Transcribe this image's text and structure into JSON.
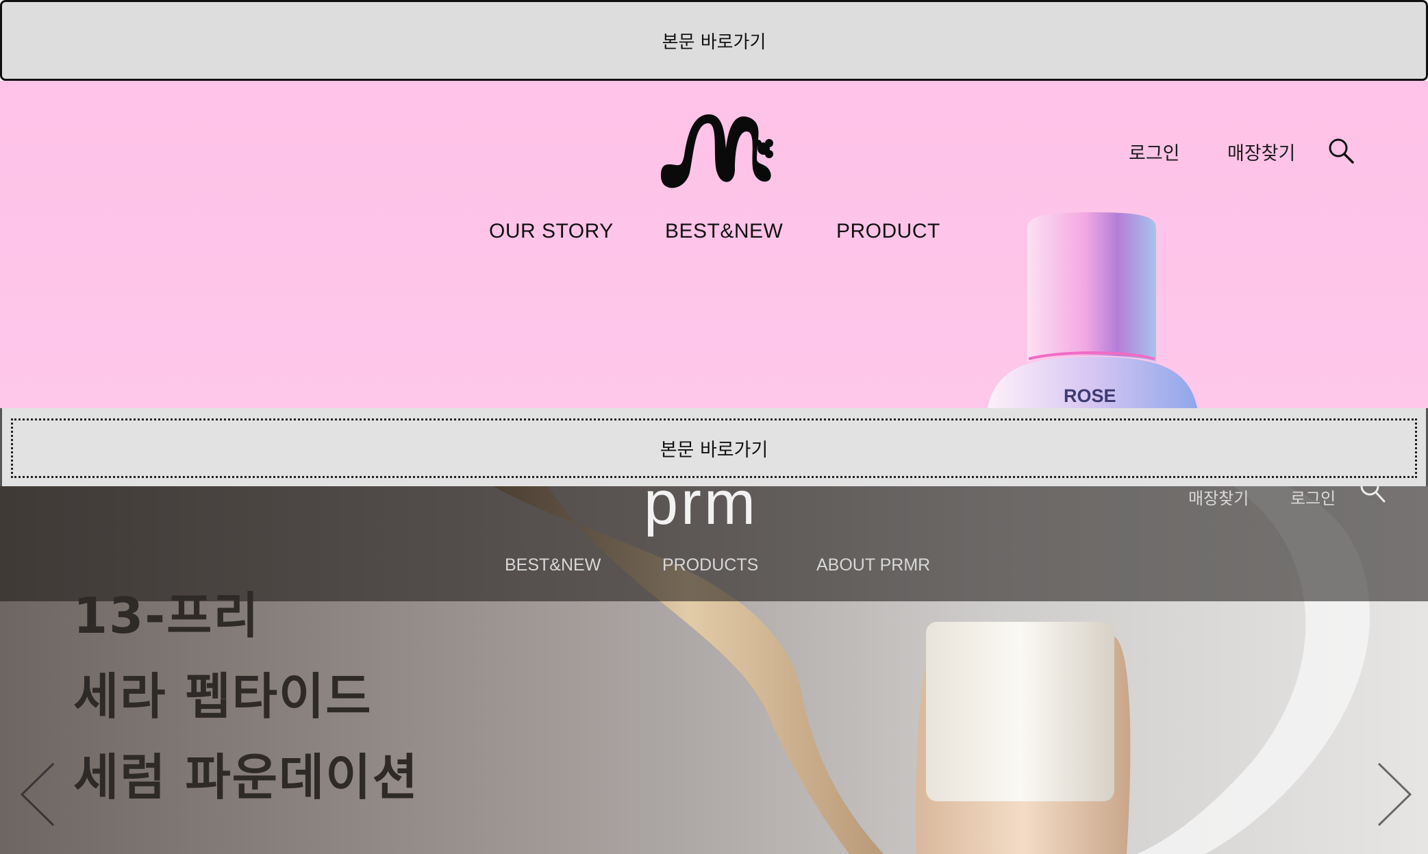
{
  "skip_link_1": {
    "label": "본문 바로가기"
  },
  "header_1": {
    "utility": {
      "login": "로그인",
      "store_finder": "매장찾기"
    },
    "nav": [
      "OUR STORY",
      "BEST&NEW",
      "PRODUCT"
    ],
    "hero": {
      "product_label": "ROSE",
      "background_color": "#fec4e9"
    }
  },
  "skip_link_2": {
    "label": "본문 바로가기"
  },
  "header_2": {
    "logo_text": "prm",
    "utility": {
      "store_finder": "매장찾기",
      "login": "로그인"
    },
    "nav": [
      "BEST&NEW",
      "PRODUCTS",
      "ABOUT PRMR"
    ],
    "hero": {
      "title_lines": [
        "13-프리",
        "세라 펩타이드",
        "세럼 파운데이션"
      ]
    }
  },
  "icons": [
    "logo-m-icon",
    "search-icon",
    "chevron-left-icon",
    "chevron-right-icon"
  ]
}
